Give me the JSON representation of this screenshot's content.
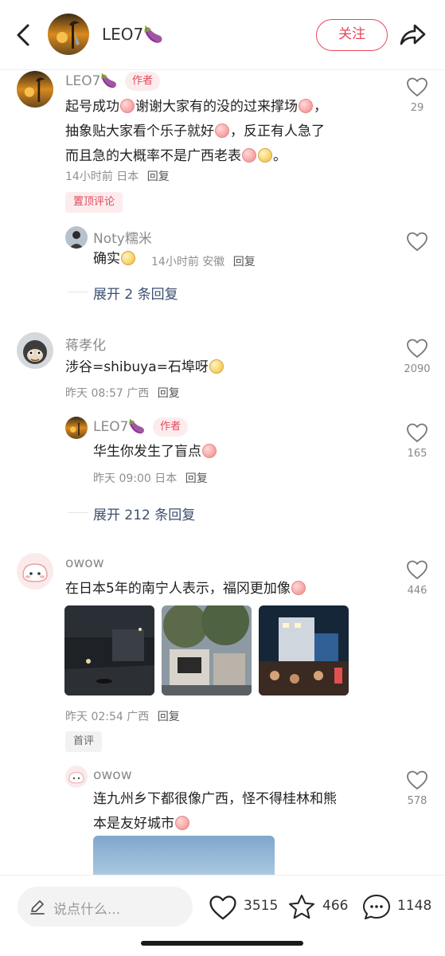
{
  "header": {
    "username": "LEO7🍆",
    "follow_label": "关注"
  },
  "comments": [
    {
      "username": "LEO7🍆",
      "author_badge": "作者",
      "text_lines": [
        "起号成功",
        "谢谢大家有的没的过来撑场",
        "，",
        "抽象贴大家看个乐子就好",
        "，反正有人急了",
        "而且急的大概率不是广西老表",
        "。"
      ],
      "meta_time": "14小时前",
      "meta_location": "日本",
      "reply_label": "回复",
      "likes": "29",
      "tag": "置顶评论",
      "replies": [
        {
          "username": "Noty糯米",
          "text": "确实",
          "meta_time": "14小时前",
          "meta_location": "安徽",
          "reply_label": "回复"
        }
      ],
      "expand_label": "展开 2 条回复"
    },
    {
      "username": "蒋孝化",
      "text": "涉谷=shibuya=石埠呀",
      "meta_time": "昨天 08:57",
      "meta_location": "广西",
      "reply_label": "回复",
      "likes": "2090",
      "replies": [
        {
          "username": "LEO7🍆",
          "author_badge": "作者",
          "text": "华生你发生了盲点",
          "meta_time": "昨天 09:00",
          "meta_location": "日本",
          "reply_label": "回复",
          "likes": "165"
        }
      ],
      "expand_label": "展开 212 条回复"
    },
    {
      "username": "owow",
      "text": "在日本5年的南宁人表示，福冈更加像",
      "meta_time": "昨天 02:54",
      "meta_location": "广西",
      "reply_label": "回复",
      "likes": "446",
      "tag": "首评",
      "replies": [
        {
          "username": "owow",
          "text_line1": "连九州乡下都很像广西，怪不得桂林和熊",
          "text_line2": "本是友好城市",
          "likes": "578"
        }
      ]
    }
  ],
  "bottom_bar": {
    "input_placeholder": "说点什么...",
    "like_count": "3515",
    "star_count": "466",
    "comment_count": "1148"
  },
  "colors": {
    "accent": "#e8485b",
    "expand_link": "#3c4f6e",
    "badge_bg": "#fdecee"
  }
}
